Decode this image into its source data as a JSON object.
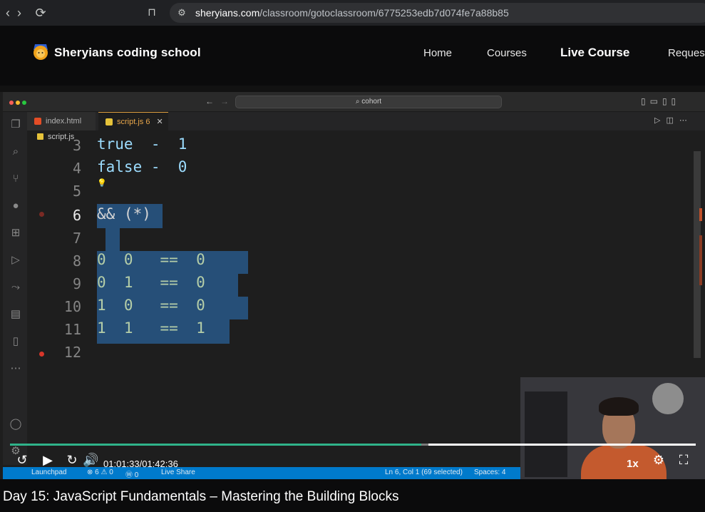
{
  "browser": {
    "url_host": "sheryians.com",
    "url_path": "/classroom/gotoclassroom/6775253edb7d074fe7a88b85"
  },
  "site": {
    "logo_text": "Sheryians coding school",
    "nav": [
      "Home",
      "Courses",
      "Live Course",
      "Request"
    ],
    "active_nav": "Live Course"
  },
  "editor": {
    "command_center": "cohort",
    "tabs": [
      {
        "label": "index.html",
        "active": false
      },
      {
        "label": "script.js 6",
        "active": true
      }
    ],
    "breadcrumb": "script.js",
    "lines": [
      {
        "n": "3",
        "text": "true  -  1"
      },
      {
        "n": "4",
        "text": "false -  0"
      },
      {
        "n": "5",
        "text": ""
      },
      {
        "n": "6",
        "text": "&& (*)"
      },
      {
        "n": "7",
        "text": ""
      },
      {
        "n": "8",
        "text": "0  0   ==  0"
      },
      {
        "n": "9",
        "text": "0  1   ==  0"
      },
      {
        "n": "10",
        "text": "1  0   ==  0"
      },
      {
        "n": "11",
        "text": "1  1   ==  1"
      },
      {
        "n": "12",
        "text": ""
      }
    ],
    "status": {
      "launchpad": "Launchpad",
      "problems": "⊗ 6 ⚠ 0",
      "ports": "Ⓦ 0",
      "live_share": "Live Share",
      "cursor": "Ln 6, Col 1 (69 selected)",
      "spaces": "Spaces: 4"
    }
  },
  "player": {
    "time": "01:01:33/01:42:36",
    "speed": "1x",
    "played_fraction": 0.6,
    "buffered_fraction": 0.61
  },
  "video_title": "Day 15: JavaScript Fundamentals – Mastering the Building Blocks",
  "colors": {
    "accent_progress": "#2fb38a",
    "selection": "#264f78",
    "statusbar": "#007acc"
  }
}
